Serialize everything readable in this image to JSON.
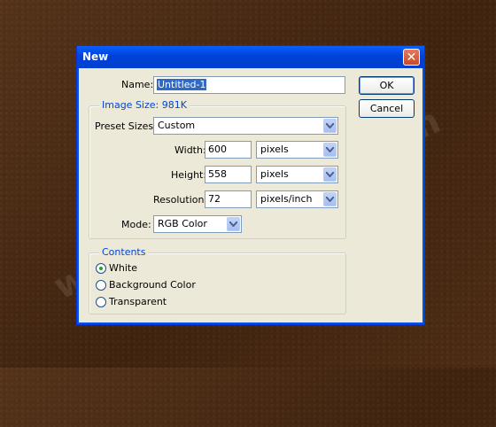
{
  "watermark": "www.psd-dude.com",
  "dialog": {
    "title": "New",
    "close_glyph": "✕",
    "name_label": "Name:",
    "name_value": "Untitled-1",
    "ok_label": "OK",
    "cancel_label": "Cancel",
    "image_size_label": "Image Size: 981K",
    "preset_label": "Preset Sizes:",
    "preset_value": "Custom",
    "width_label": "Width:",
    "width_value": "600",
    "width_unit": "pixels",
    "height_label": "Height:",
    "height_value": "558",
    "height_unit": "pixels",
    "resolution_label": "Resolution:",
    "resolution_value": "72",
    "resolution_unit": "pixels/inch",
    "mode_label": "Mode:",
    "mode_value": "RGB Color",
    "contents_label": "Contents",
    "contents_options": [
      {
        "label": "White",
        "checked": true
      },
      {
        "label": "Background Color",
        "checked": false
      },
      {
        "label": "Transparent",
        "checked": false
      }
    ]
  },
  "colors": {
    "titlebar": "#0042d8",
    "dialog_bg": "#ece9d8",
    "group_title": "#0046d5",
    "desktop": "#4a2a12"
  }
}
